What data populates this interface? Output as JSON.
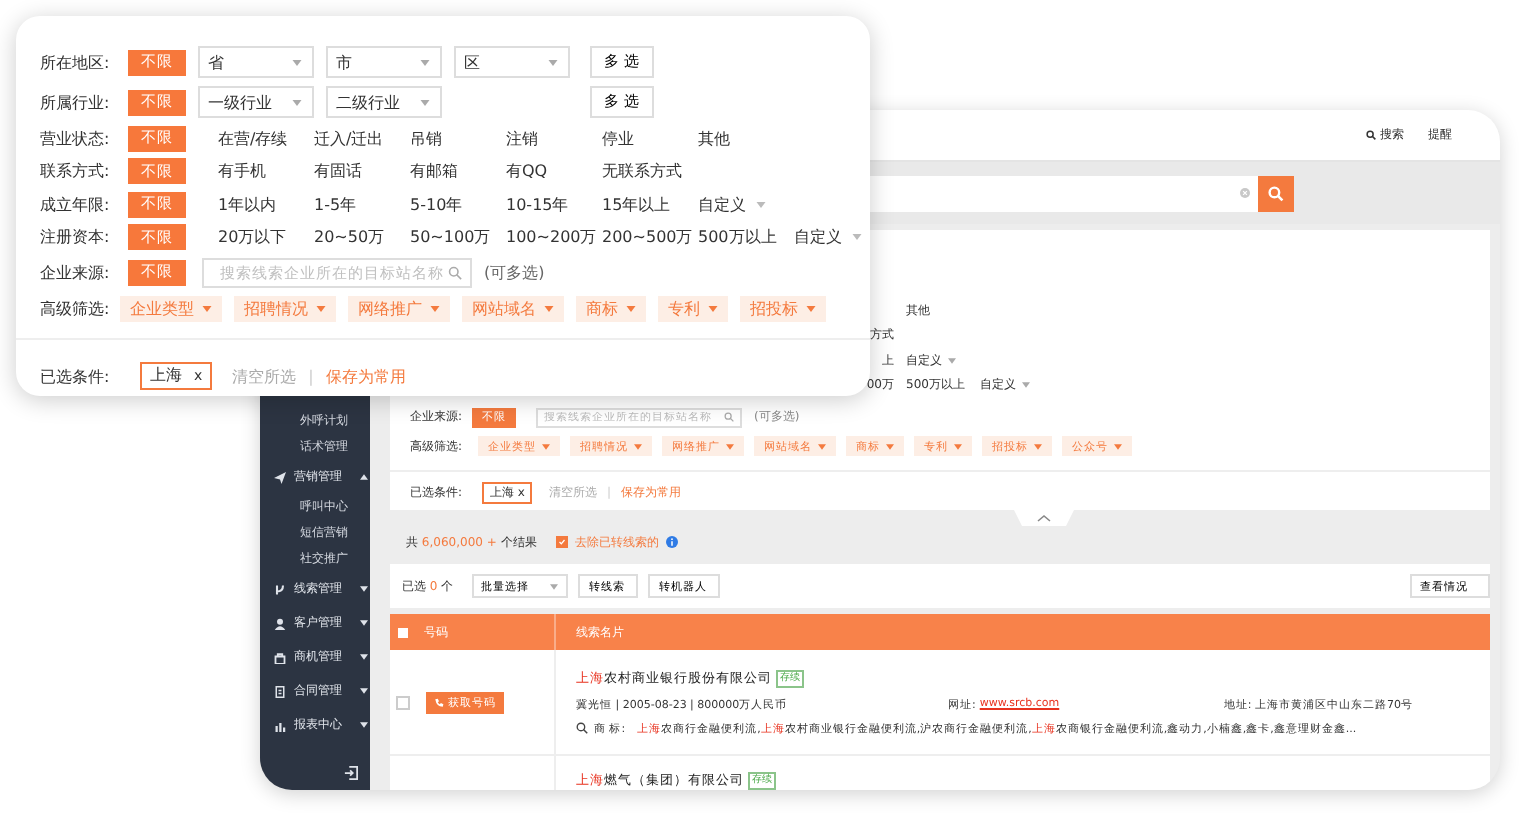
{
  "background_window": {
    "top_bar": {
      "actions": [
        "搜索",
        "提醒"
      ]
    },
    "sidebar": {
      "items": [
        {
          "kind": "sub",
          "label": "外呼计划"
        },
        {
          "kind": "sub",
          "label": "话术管理"
        },
        {
          "kind": "group",
          "label": "营销管理",
          "expanded": true
        },
        {
          "kind": "sub",
          "label": "呼叫中心"
        },
        {
          "kind": "sub",
          "label": "短信营销"
        },
        {
          "kind": "sub",
          "label": "社交推广"
        },
        {
          "kind": "group",
          "label": "线索管理",
          "expanded": false
        },
        {
          "kind": "group",
          "label": "客户管理",
          "expanded": false
        },
        {
          "kind": "group",
          "label": "商机管理",
          "expanded": false
        },
        {
          "kind": "group",
          "label": "合同管理",
          "expanded": false
        },
        {
          "kind": "group",
          "label": "报表中心",
          "expanded": false
        }
      ]
    },
    "filters": {
      "rows": [
        {
          "options": [
            {
              "kind": "option",
              "label": "其他"
            }
          ]
        },
        {
          "cut_text": "方式"
        },
        {
          "cut_text": "上",
          "options": [
            {
              "kind": "dropdown",
              "label": "自定义"
            }
          ]
        },
        {
          "cut_text": "00万",
          "options": [
            {
              "kind": "option",
              "label": "500万以上"
            },
            {
              "kind": "dropdown",
              "label": "自定义"
            }
          ]
        }
      ],
      "source": {
        "label": "企业来源:",
        "any": {
          "label": "不限",
          "selected": true
        },
        "placeholder": "搜索线索企业所在的目标站名称",
        "hint": "(可多选)"
      },
      "advanced": {
        "label": "高级筛选:",
        "tags": [
          "企业类型",
          "招聘情况",
          "网络推广",
          "网站域名",
          "商标",
          "专利",
          "招投标",
          "公众号"
        ]
      },
      "chosen": {
        "label": "已选条件:",
        "chips": [
          {
            "label": "上海",
            "remove": "x"
          }
        ],
        "clear": "清空所选",
        "separator": "|",
        "save": "保存为常用"
      }
    },
    "results": {
      "prefix": "共",
      "count": "6,060,000 +",
      "suffix": "个结果",
      "exclude": {
        "label": "去除已转线索的",
        "checked": true
      }
    },
    "toolbar": {
      "selected_prefix": "已选",
      "selected_count": "0",
      "selected_suffix": "个",
      "batch": "批量选择",
      "buttons": [
        "转线索",
        "转机器人"
      ],
      "view": "查看情况"
    },
    "table": {
      "columns": [
        "号码",
        "线索名片"
      ],
      "select_all_checked": false,
      "rows": [
        {
          "checked": false,
          "action": "获取号码",
          "name": [
            {
              "text": "上海",
              "highlight": true
            },
            {
              "text": "农村商业银行股份有限公司",
              "highlight": false
            }
          ],
          "status": "存续",
          "details": "冀光恒  |  2005-08-23  |  800000万人民币",
          "website_label": "网址:",
          "website": "www.srcb.com",
          "address": "地址: 上海市黄浦区中山东二路70号",
          "trademark_label": "商  标:",
          "trademark": [
            {
              "text": "上海",
              "highlight": true
            },
            {
              "text": "农商行金融便利流,",
              "highlight": false
            },
            {
              "text": "上海",
              "highlight": true
            },
            {
              "text": "农村商业银行金融便利流,沪农商行金融便利流,",
              "highlight": false
            },
            {
              "text": "上海",
              "highlight": true
            },
            {
              "text": "农商银行金融便利流,鑫动力,小楠鑫,鑫卡,鑫意理财金鑫...",
              "highlight": false
            }
          ]
        },
        {
          "name": [
            {
              "text": "上海",
              "highlight": true
            },
            {
              "text": "燃气（集团）有限公司",
              "highlight": false
            }
          ],
          "status": "存续"
        }
      ]
    }
  },
  "filter_panel": {
    "rows": [
      {
        "kind": "selects",
        "label": "所在地区:",
        "any": {
          "label": "不限",
          "selected": true
        },
        "selects": [
          "省",
          "市",
          "区"
        ],
        "multi": "多 选"
      },
      {
        "kind": "selects",
        "label": "所属行业:",
        "any": {
          "label": "不限",
          "selected": true
        },
        "selects": [
          "一级行业",
          "二级行业"
        ],
        "multi": "多 选"
      },
      {
        "kind": "options",
        "label": "营业状态:",
        "any": {
          "label": "不限",
          "selected": true
        },
        "options": [
          "在营/存续",
          "迁入/迁出",
          "吊销",
          "注销",
          "停业",
          "其他"
        ]
      },
      {
        "kind": "options",
        "label": "联系方式:",
        "any": {
          "label": "不限",
          "selected": true
        },
        "options": [
          "有手机",
          "有固话",
          "有邮箱",
          "有QQ",
          "无联系方式"
        ]
      },
      {
        "kind": "options",
        "label": "成立年限:",
        "any": {
          "label": "不限",
          "selected": true
        },
        "options": [
          "1年以内",
          "1-5年",
          "5-10年",
          "10-15年",
          "15年以上"
        ],
        "custom": "自定义"
      },
      {
        "kind": "options",
        "label": "注册资本:",
        "any": {
          "label": "不限",
          "selected": true
        },
        "options": [
          "20万以下",
          "20~50万",
          "50~100万",
          "100~200万",
          "200~500万",
          "500万以上"
        ],
        "custom": "自定义"
      },
      {
        "kind": "search",
        "label": "企业来源:",
        "any": {
          "label": "不限",
          "selected": true
        },
        "placeholder": "搜索线索企业所在的目标站名称",
        "hint": "(可多选)"
      },
      {
        "kind": "tags",
        "label": "高级筛选:",
        "tags": [
          "企业类型",
          "招聘情况",
          "网络推广",
          "网站域名",
          "商标",
          "专利",
          "招投标"
        ]
      }
    ],
    "chosen": {
      "label": "已选条件:",
      "chips": [
        {
          "label": "上海",
          "remove": "x"
        }
      ],
      "clear": "清空所选",
      "separator": "|",
      "save": "保存为常用"
    }
  }
}
